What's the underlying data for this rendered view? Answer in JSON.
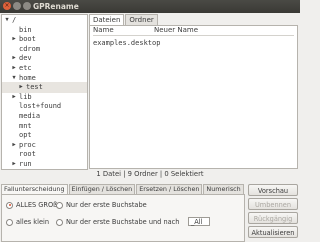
{
  "window": {
    "title": "GPRename",
    "close_glyph": "×"
  },
  "tree": {
    "items": [
      {
        "label": "/",
        "arrow": "▼",
        "indent": 0,
        "selected": false
      },
      {
        "label": "bin",
        "arrow": "",
        "indent": 1,
        "selected": false
      },
      {
        "label": "boot",
        "arrow": "▶",
        "indent": 1,
        "selected": false
      },
      {
        "label": "cdrom",
        "arrow": "",
        "indent": 1,
        "selected": false
      },
      {
        "label": "dev",
        "arrow": "▶",
        "indent": 1,
        "selected": false
      },
      {
        "label": "etc",
        "arrow": "▶",
        "indent": 1,
        "selected": false
      },
      {
        "label": "home",
        "arrow": "▼",
        "indent": 1,
        "selected": false
      },
      {
        "label": "test",
        "arrow": "▶",
        "indent": 2,
        "selected": true
      },
      {
        "label": "lib",
        "arrow": "▶",
        "indent": 1,
        "selected": false
      },
      {
        "label": "lost+found",
        "arrow": "",
        "indent": 1,
        "selected": false
      },
      {
        "label": "media",
        "arrow": "",
        "indent": 1,
        "selected": false
      },
      {
        "label": "mnt",
        "arrow": "",
        "indent": 1,
        "selected": false
      },
      {
        "label": "opt",
        "arrow": "",
        "indent": 1,
        "selected": false
      },
      {
        "label": "proc",
        "arrow": "▶",
        "indent": 1,
        "selected": false
      },
      {
        "label": "root",
        "arrow": "",
        "indent": 1,
        "selected": false
      },
      {
        "label": "run",
        "arrow": "▶",
        "indent": 1,
        "selected": false
      }
    ]
  },
  "filepane": {
    "tabs": [
      "Dateien",
      "Ordner"
    ],
    "columns": [
      "Name",
      "Neuer Name"
    ],
    "rows": [
      "examples.desktop"
    ]
  },
  "status": "1 Datei | 9 Ordner | 0 Selektiert",
  "options": {
    "tabs": [
      "Fallunterscheidung",
      "Einfügen / Löschen",
      "Ersetzen / Löschen",
      "Numerisch"
    ],
    "radios": {
      "all_upper": "ALLES GROß",
      "all_lower": "alles klein",
      "first_letter": "Nur der erste Buchstabe",
      "first_letter_after": "Nur der erste Buchstabe und nach"
    },
    "after_value": "_All"
  },
  "buttons": {
    "preview": "Vorschau",
    "rename": "Umbennen",
    "undo": "Rückgängig",
    "refresh": "Aktualisieren"
  }
}
